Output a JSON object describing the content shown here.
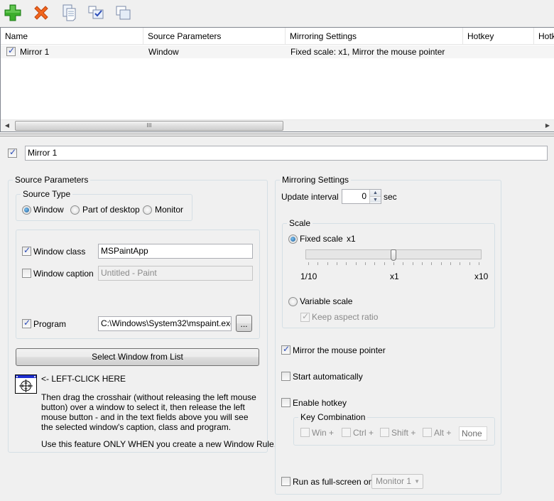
{
  "toolbar": {
    "buttons": [
      {
        "name": "add-rule",
        "icon": "green-plus-icon"
      },
      {
        "name": "delete-rule",
        "icon": "orange-x-icon"
      },
      {
        "name": "copy-rule",
        "icon": "copy-document-icon"
      },
      {
        "name": "check-all",
        "icon": "check-list-icon"
      },
      {
        "name": "duplicate-windows",
        "icon": "cascade-windows-icon"
      }
    ]
  },
  "list": {
    "columns": [
      "Name",
      "Source Parameters",
      "Mirroring Settings",
      "Hotkey",
      "Hotk"
    ],
    "rows": [
      {
        "checked": true,
        "name": "Mirror 1",
        "source": "Window",
        "mirroring": "Fixed scale: x1, Mirror the mouse pointer",
        "hotkey": "",
        "hotkey2": ""
      }
    ],
    "scroll_thumb_glyph": "III"
  },
  "rule": {
    "enabled": true,
    "name": "Mirror 1"
  },
  "source": {
    "title": "Source Parameters",
    "type_title": "Source Type",
    "types": [
      "Window",
      "Part of desktop",
      "Monitor"
    ],
    "selected_type": "Window",
    "window_class_label": "Window class",
    "window_class_checked": true,
    "window_class_value": "MSPaintApp",
    "window_caption_label": "Window caption",
    "window_caption_checked": false,
    "window_caption_value": "Untitled - Paint",
    "program_label": "Program",
    "program_checked": true,
    "program_value": "C:\\Windows\\System32\\mspaint.exe",
    "browse_label": "...",
    "select_window_label": "Select Window from List",
    "left_click_label": "<- LEFT-CLICK HERE",
    "instructions_1": "Then drag the crosshair (without releasing the left mouse button) over a window to select it, then release the left mouse button - and in the text fields above you will see the selected window's caption, class and program.",
    "instructions_2": "Use this feature ONLY WHEN you create a new Window Rule."
  },
  "mirroring": {
    "title": "Mirroring Settings",
    "update_interval_label": "Update interval",
    "update_interval_value": "0",
    "update_interval_unit": "sec",
    "scale_title": "Scale",
    "fixed_scale_label": "Fixed scale",
    "fixed_scale_selected": true,
    "fixed_scale_value": "x1",
    "slider_min_label": "1/10",
    "slider_mid_label": "x1",
    "slider_max_label": "x10",
    "slider_position": 0.5,
    "variable_scale_label": "Variable scale",
    "variable_scale_selected": false,
    "keep_aspect_label": "Keep aspect ratio",
    "keep_aspect_checked": true,
    "mirror_pointer_label": "Mirror the mouse pointer",
    "mirror_pointer_checked": true,
    "start_auto_label": "Start automatically",
    "start_auto_checked": false,
    "enable_hotkey_label": "Enable hotkey",
    "enable_hotkey_checked": false,
    "key_combination_title": "Key Combination",
    "modifiers": [
      "Win +",
      "Ctrl +",
      "Shift +",
      "Alt +"
    ],
    "hotkey_value": "None",
    "fullscreen_label": "Run as full-screen on",
    "fullscreen_checked": false,
    "fullscreen_monitor": "Monitor 1"
  }
}
